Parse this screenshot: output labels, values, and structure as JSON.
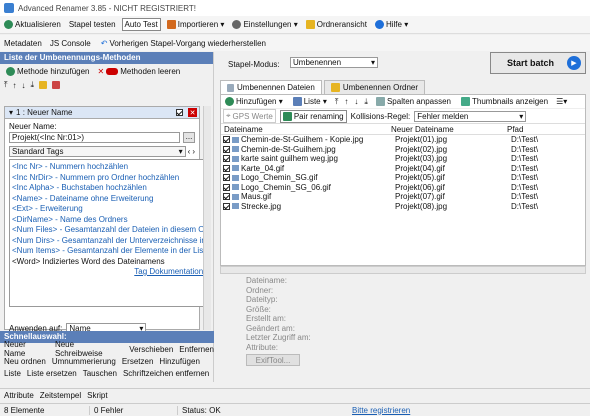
{
  "window": {
    "title": "Advanced Renamer 3.85 - NICHT REGISTRIERT!"
  },
  "toolbar": {
    "items": [
      {
        "label": "Aktualisieren",
        "icon": "refresh-icon"
      },
      {
        "label": "Stapel testen",
        "icon": ""
      },
      {
        "label": "Auto Test",
        "icon": ""
      },
      {
        "label": "Importieren ▾",
        "icon": "import-icon"
      },
      {
        "label": "Einstellungen ▾",
        "icon": "gear-icon"
      },
      {
        "label": "Ordneransicht",
        "icon": "folder-icon"
      },
      {
        "label": "Hilfe ▾",
        "icon": "help-icon"
      }
    ]
  },
  "toolbar2": {
    "metadata": "Metadaten",
    "js_console": "JS Console",
    "restore": "Vorherigen Stapel-Vorgang wiederherstellen"
  },
  "left": {
    "header": "Liste der Umbenennungs-Methoden",
    "add_method": "Methode hinzufügen",
    "clear_methods": "Methoden leeren",
    "method_title": "1 : Neuer Name",
    "new_name_label": "Neuer Name:",
    "new_name_value": "Projekt(<Inc Nr:01>)",
    "tags_select": "Standard Tags",
    "tags": [
      "<Inc Nr> - Nummern hochzählen",
      "<Inc NrDir> - Nummern pro Ordner hochzählen",
      "<Inc Alpha> - Buchstaben hochzählen",
      "<Name> - Dateiname ohne Erweiterung",
      "<Ext> - Erweiterung",
      "<DirName> - Name des Ordners",
      "<Num Files> - Gesamtanzahl der Dateien in diesem Or",
      "<Num Dirs> - Gesamtanzahl der Unterverzeichnisse in",
      "<Num Items> - Gesamtanzahl der Elemente in der Lis",
      "<Word> Indiziertes Word des Dateinamens"
    ],
    "tag_doc": "Tag Dokumentation",
    "apply_label": "Anwenden auf:",
    "apply_value": "Name",
    "quick_header": "Schnellauswahl:",
    "quick_rows": [
      [
        "Neuer Name",
        "Neue Schreibweise",
        "Verschieben",
        "Entfernen"
      ],
      [
        "Neu ordnen",
        "Umnummerierung",
        "Ersetzen",
        "Hinzufügen"
      ],
      [
        "Liste",
        "Liste ersetzen",
        "Tauschen",
        "Schriftzeichen entfernen"
      ]
    ]
  },
  "right": {
    "mode_label": "Stapel-Modus:",
    "mode_value": "Umbenennen",
    "start_batch": "Start batch",
    "tab_files": "Umbenennen Dateien",
    "tab_folders": "Umbenennen Ordner",
    "add": "Hinzufügen ▾",
    "list": "Liste ▾",
    "columns_adjust": "Spalten anpassen",
    "thumbnails": "Thumbnails anzeigen",
    "gps": "GPS Werte",
    "pair": "Pair renaming",
    "collision_label": "Kollisions-Regel:",
    "collision_value": "Fehler melden",
    "columns": [
      "Dateiname",
      "Neuer Dateiname",
      "Pfad"
    ],
    "files": [
      {
        "name": "Chemin-de-St-Guilhem - Kopie.jpg",
        "new": "Projekt(01).jpg",
        "path": "D:\\Test\\"
      },
      {
        "name": "Chemin-de-St-Guilhem.jpg",
        "new": "Projekt(02).jpg",
        "path": "D:\\Test\\"
      },
      {
        "name": "karte saint guilhem weg.jpg",
        "new": "Projekt(03).jpg",
        "path": "D:\\Test\\"
      },
      {
        "name": "Karte_04.gif",
        "new": "Projekt(04).gif",
        "path": "D:\\Test\\"
      },
      {
        "name": "Logo_Chemin_SG.gif",
        "new": "Projekt(05).gif",
        "path": "D:\\Test\\"
      },
      {
        "name": "Logo_Chemin_SG_06.gif",
        "new": "Projekt(06).gif",
        "path": "D:\\Test\\"
      },
      {
        "name": "Maus.gif",
        "new": "Projekt(07).gif",
        "path": "D:\\Test\\"
      },
      {
        "name": "Strecke.jpg",
        "new": "Projekt(08).jpg",
        "path": "D:\\Test\\"
      }
    ],
    "properties": [
      "Dateiname:",
      "Ordner:",
      "Dateityp:",
      "Größe:",
      "Erstellt am:",
      "Geändert am:",
      "Letzter Zugriff am:",
      "Attribute:"
    ],
    "exif": "ExifTool..."
  },
  "bottom_tabs": [
    "Attribute",
    "Zeitstempel",
    "Skript"
  ],
  "status": {
    "count": "8 Elemente",
    "errors": "0 Fehler",
    "status": "Status: OK",
    "register": "Bitte registrieren"
  },
  "colors": {
    "accent": "#1e6fd9",
    "header": "#5b7fb8",
    "link": "#1a5fb4"
  }
}
